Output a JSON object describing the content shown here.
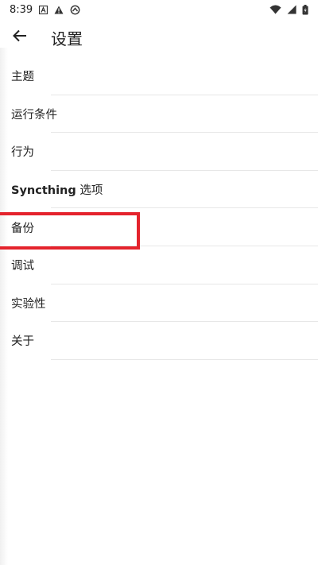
{
  "status_bar": {
    "time": "8:39",
    "icons": [
      "a-box-icon",
      "warning-icon",
      "sync-icon"
    ],
    "right_icons": [
      "wifi-icon",
      "signal-icon",
      "battery-icon"
    ]
  },
  "app_bar": {
    "back_icon": "arrow-left-icon",
    "title": "设置"
  },
  "settings": {
    "items": [
      {
        "label": "主题"
      },
      {
        "label": "运行条件"
      },
      {
        "label": "行为"
      },
      {
        "label": "Syncthing 选项"
      },
      {
        "label": "备份"
      },
      {
        "label": "调试"
      },
      {
        "label": "实验性"
      },
      {
        "label": "关于"
      }
    ]
  },
  "colors": {
    "highlight": "#e4232c",
    "text": "#222222",
    "divider": "#e7e7e7"
  }
}
